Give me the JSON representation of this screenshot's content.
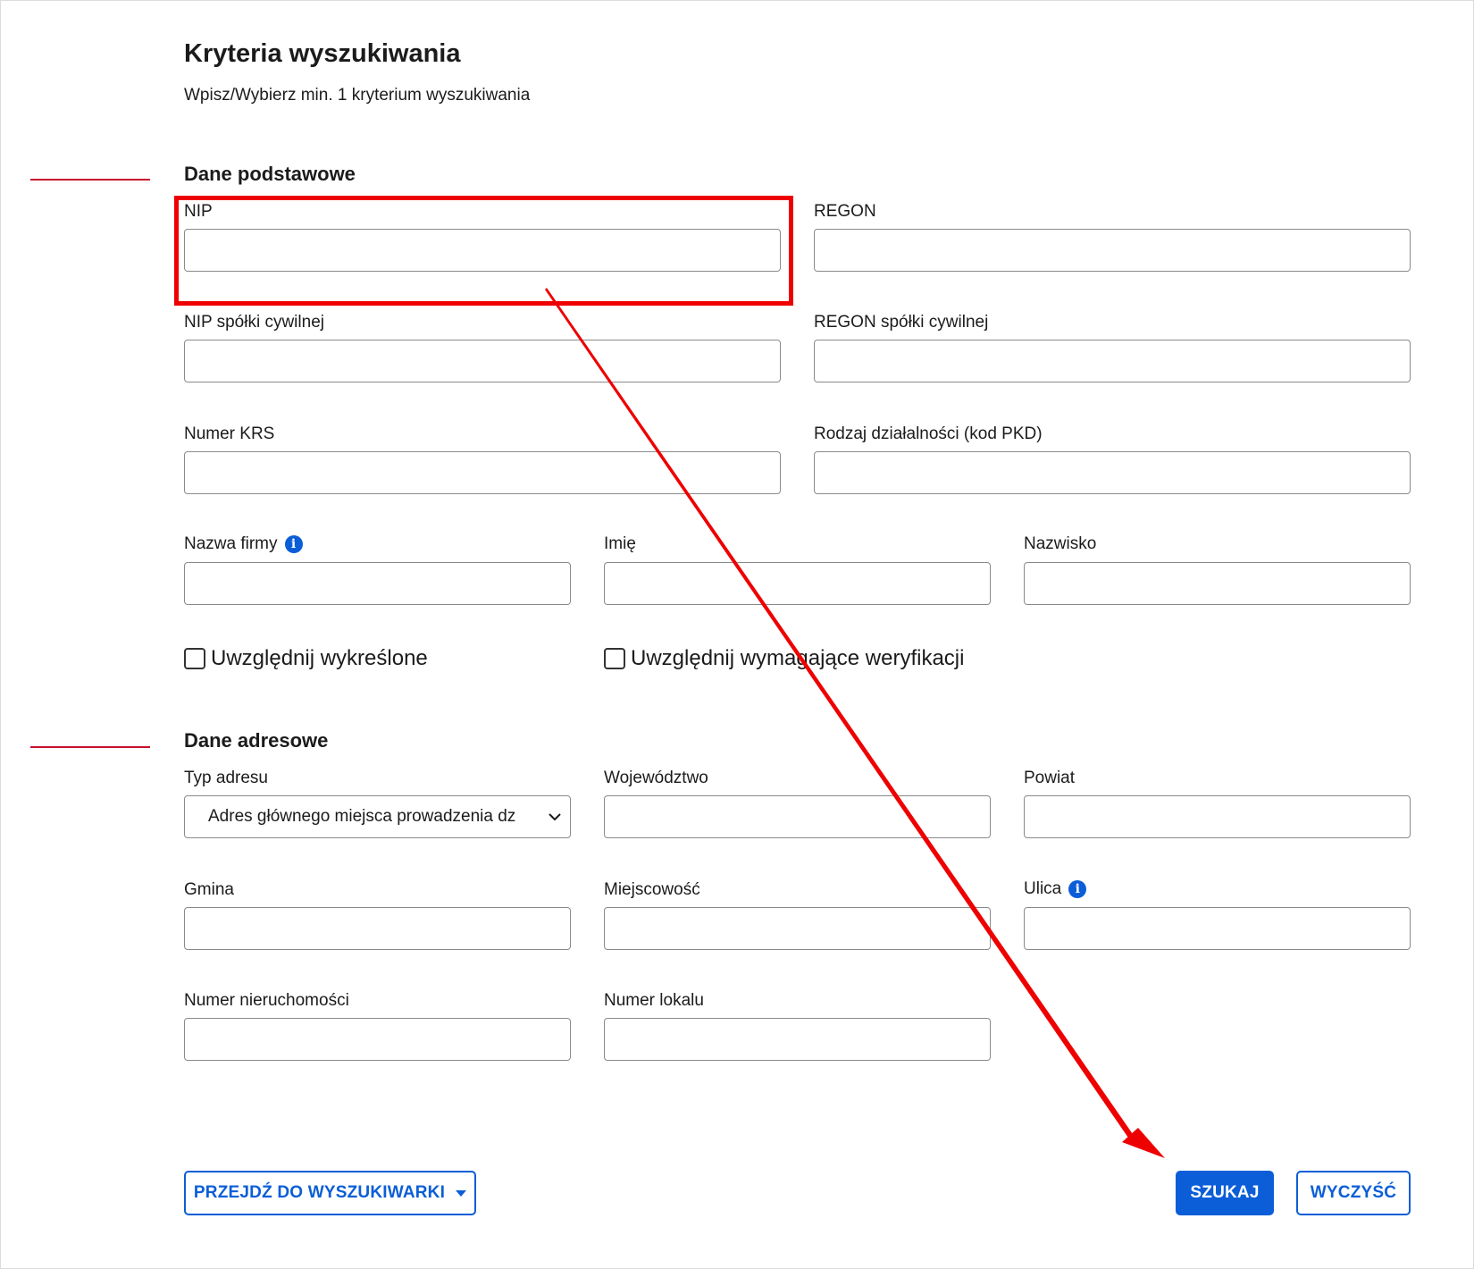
{
  "header": {
    "title": "Kryteria wyszukiwania",
    "subtitle": "Wpisz/Wybierz min. 1 kryterium wyszukiwania"
  },
  "sections": {
    "basic": {
      "heading": "Dane podstawowe"
    },
    "address": {
      "heading": "Dane adresowe"
    }
  },
  "basic_fields": {
    "nip": {
      "label": "NIP",
      "value": ""
    },
    "regon": {
      "label": "REGON",
      "value": ""
    },
    "nip_civil": {
      "label": "NIP spółki cywilnej",
      "value": ""
    },
    "regon_civil": {
      "label": "REGON spółki cywilnej",
      "value": ""
    },
    "krs": {
      "label": "Numer KRS",
      "value": ""
    },
    "pkd": {
      "label": "Rodzaj działalności (kod PKD)",
      "value": ""
    },
    "company_name": {
      "label": "Nazwa firmy",
      "value": ""
    },
    "first_name": {
      "label": "Imię",
      "value": ""
    },
    "last_name": {
      "label": "Nazwisko",
      "value": ""
    }
  },
  "checkboxes": {
    "deleted": {
      "label": "Uwzględnij wykreślone",
      "checked": false
    },
    "verification": {
      "label": "Uwzględnij wymagające weryfikacji",
      "checked": false
    }
  },
  "address_fields": {
    "address_type": {
      "label": "Typ adresu",
      "selected": "Adres głównego miejsca prowadzenia dz"
    },
    "voivodeship": {
      "label": "Województwo",
      "value": ""
    },
    "county": {
      "label": "Powiat",
      "value": ""
    },
    "commune": {
      "label": "Gmina",
      "value": ""
    },
    "locality": {
      "label": "Miejscowość",
      "value": ""
    },
    "street": {
      "label": "Ulica",
      "value": ""
    },
    "property_number": {
      "label": "Numer nieruchomości",
      "value": ""
    },
    "unit_number": {
      "label": "Numer lokalu",
      "value": ""
    }
  },
  "buttons": {
    "go_to_search": "PRZEJDŹ DO WYSZUKIWARKI",
    "search": "SZUKAJ",
    "clear": "WYCZYŚĆ"
  },
  "icons": {
    "info": "info-icon",
    "dropdown": "chevron-down-icon",
    "menu_caret": "caret-down-icon"
  },
  "colors": {
    "primary": "#0b5ed7",
    "annotation": "#ee0000",
    "section_marker": "#c8102e"
  }
}
